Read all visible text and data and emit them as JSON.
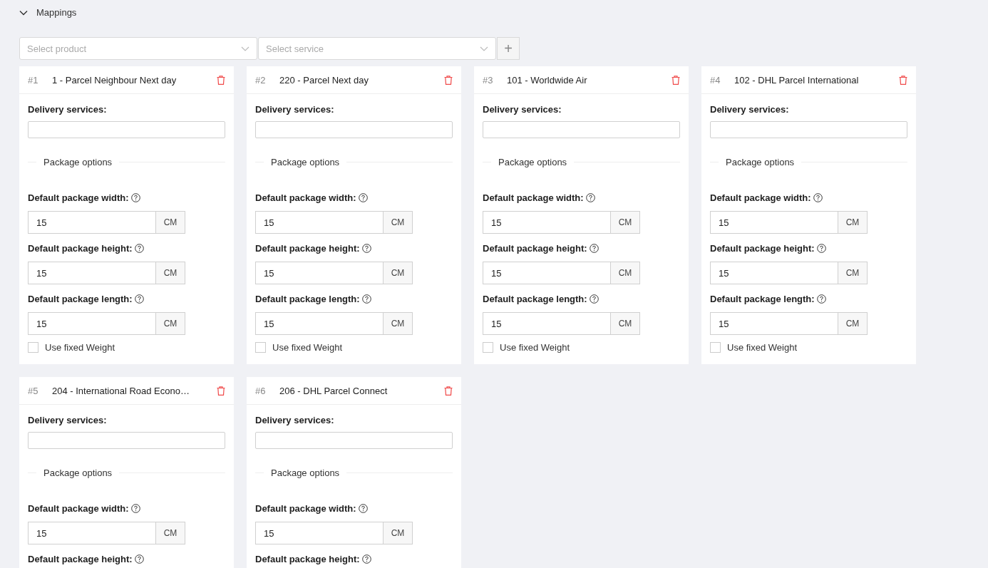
{
  "section": {
    "title": "Mappings",
    "expanded": true
  },
  "selectors": [
    {
      "placeholder": "Select product"
    },
    {
      "placeholder": "Select service"
    }
  ],
  "add_button": "+",
  "cards": [
    {
      "number": "#1",
      "title": "1 - Parcel Neighbour Next day",
      "services_label": "Delivery services:",
      "options_label": "Package options",
      "fields": [
        {
          "label": "Default package width:",
          "value": "15",
          "unit": "CM"
        },
        {
          "label": "Default package height:",
          "value": "15",
          "unit": "CM"
        },
        {
          "label": "Default package length:",
          "value": "15",
          "unit": "CM"
        }
      ],
      "fixed_weight": {
        "label": "Use fixed Weight",
        "checked": false
      }
    },
    {
      "number": "#2",
      "title": "220 - Parcel Next day",
      "services_label": "Delivery services:",
      "options_label": "Package options",
      "fields": [
        {
          "label": "Default package width:",
          "value": "15",
          "unit": "CM"
        },
        {
          "label": "Default package height:",
          "value": "15",
          "unit": "CM"
        },
        {
          "label": "Default package length:",
          "value": "15",
          "unit": "CM"
        }
      ],
      "fixed_weight": {
        "label": "Use fixed Weight",
        "checked": false
      }
    },
    {
      "number": "#3",
      "title": "101 - Worldwide Air",
      "services_label": "Delivery services:",
      "options_label": "Package options",
      "fields": [
        {
          "label": "Default package width:",
          "value": "15",
          "unit": "CM"
        },
        {
          "label": "Default package height:",
          "value": "15",
          "unit": "CM"
        },
        {
          "label": "Default package length:",
          "value": "15",
          "unit": "CM"
        }
      ],
      "fixed_weight": {
        "label": "Use fixed Weight",
        "checked": false
      }
    },
    {
      "number": "#4",
      "title": "102 - DHL Parcel International",
      "services_label": "Delivery services:",
      "options_label": "Package options",
      "fields": [
        {
          "label": "Default package width:",
          "value": "15",
          "unit": "CM"
        },
        {
          "label": "Default package height:",
          "value": "15",
          "unit": "CM"
        },
        {
          "label": "Default package length:",
          "value": "15",
          "unit": "CM"
        }
      ],
      "fixed_weight": {
        "label": "Use fixed Weight",
        "checked": false
      }
    },
    {
      "number": "#5",
      "title": "204 - International Road Econo…",
      "services_label": "Delivery services:",
      "options_label": "Package options",
      "fields": [
        {
          "label": "Default package width:",
          "value": "15",
          "unit": "CM"
        },
        {
          "label": "Default package height:"
        }
      ]
    },
    {
      "number": "#6",
      "title": "206 - DHL Parcel Connect",
      "services_label": "Delivery services:",
      "options_label": "Package options",
      "fields": [
        {
          "label": "Default package width:",
          "value": "15",
          "unit": "CM"
        },
        {
          "label": "Default package height:"
        }
      ]
    }
  ]
}
